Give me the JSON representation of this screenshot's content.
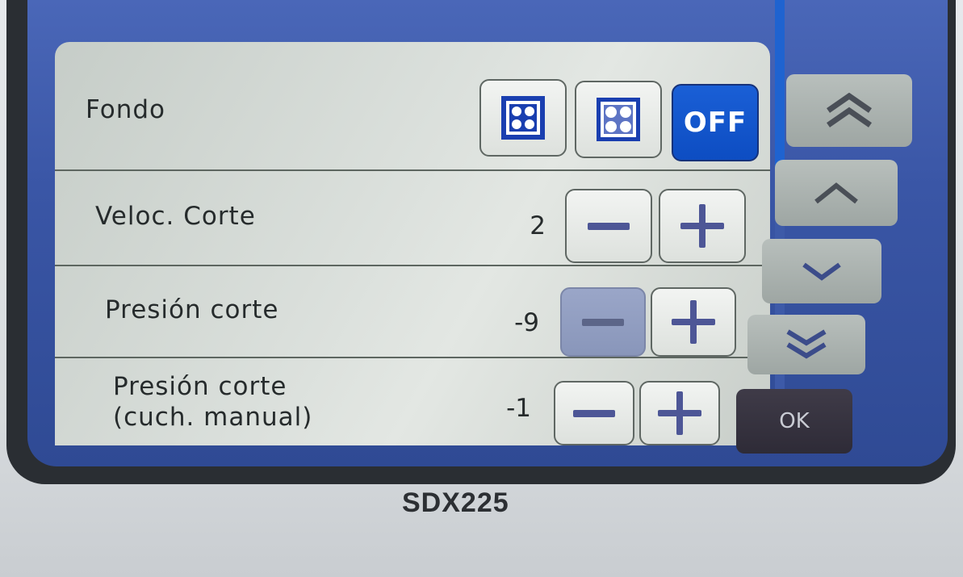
{
  "settings": {
    "background": {
      "label": "Fondo",
      "options": [
        {
          "name": "pattern-full-icon"
        },
        {
          "name": "pattern-light-icon"
        },
        {
          "name": "off",
          "label": "OFF",
          "selected": true
        }
      ]
    },
    "cut_speed": {
      "label": "Veloc. Corte",
      "value": "2"
    },
    "cut_pressure": {
      "label": "Presión corte",
      "value": "-9"
    },
    "cut_pressure_manual": {
      "label_line1": "Presión corte",
      "label_line2": "(cuch. manual)",
      "value": "-1"
    }
  },
  "nav": {
    "page_up_icon": "double-chevron-up-icon",
    "up_icon": "chevron-up-icon",
    "down_icon": "chevron-down-icon",
    "page_down_icon": "double-chevron-down-icon",
    "ok_label": "OK"
  },
  "device": {
    "model": "SDX225"
  },
  "colors": {
    "accent": "#0d4dc2",
    "icon_blue": "#1a3fb0",
    "panel": "#dbe0dc"
  }
}
